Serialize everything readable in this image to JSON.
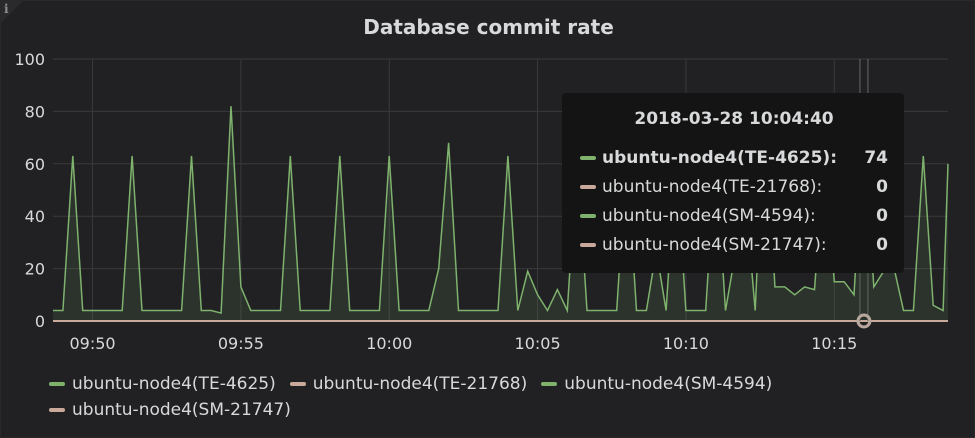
{
  "panel": {
    "title": "Database commit rate",
    "info_icon": "i"
  },
  "chart_data": {
    "type": "line",
    "title": "Database commit rate",
    "ylim": [
      0,
      100
    ],
    "yticks": [
      0,
      20,
      40,
      60,
      80,
      100
    ],
    "xlim": [
      "09:48:40",
      "10:18:50"
    ],
    "xticks": [
      "09:50",
      "09:55",
      "10:00",
      "10:05",
      "10:10",
      "10:15"
    ],
    "grid": true,
    "legend_position": "bottom",
    "series": [
      {
        "name": "ubuntu-node4(TE-4625)",
        "color": "#7eb26d",
        "points": [
          [
            "09:48:40",
            4
          ],
          [
            "09:49:00",
            4
          ],
          [
            "09:49:20",
            63
          ],
          [
            "09:49:40",
            4
          ],
          [
            "09:50:00",
            4
          ],
          [
            "09:50:20",
            4
          ],
          [
            "09:50:40",
            4
          ],
          [
            "09:51:00",
            4
          ],
          [
            "09:51:20",
            63
          ],
          [
            "09:51:40",
            4
          ],
          [
            "09:52:00",
            4
          ],
          [
            "09:52:20",
            4
          ],
          [
            "09:52:40",
            4
          ],
          [
            "09:53:00",
            4
          ],
          [
            "09:53:20",
            63
          ],
          [
            "09:53:40",
            4
          ],
          [
            "09:54:00",
            4
          ],
          [
            "09:54:20",
            3
          ],
          [
            "09:54:40",
            82
          ],
          [
            "09:55:00",
            13
          ],
          [
            "09:55:20",
            4
          ],
          [
            "09:55:40",
            4
          ],
          [
            "09:56:00",
            4
          ],
          [
            "09:56:20",
            4
          ],
          [
            "09:56:40",
            63
          ],
          [
            "09:57:00",
            4
          ],
          [
            "09:57:20",
            4
          ],
          [
            "09:57:40",
            4
          ],
          [
            "09:58:00",
            4
          ],
          [
            "09:58:20",
            63
          ],
          [
            "09:58:40",
            4
          ],
          [
            "09:59:00",
            4
          ],
          [
            "09:59:20",
            4
          ],
          [
            "09:59:40",
            4
          ],
          [
            "10:00:00",
            63
          ],
          [
            "10:00:20",
            4
          ],
          [
            "10:00:40",
            4
          ],
          [
            "10:01:00",
            4
          ],
          [
            "10:01:20",
            4
          ],
          [
            "10:01:40",
            20
          ],
          [
            "10:02:00",
            68
          ],
          [
            "10:02:20",
            4
          ],
          [
            "10:02:40",
            4
          ],
          [
            "10:03:00",
            4
          ],
          [
            "10:03:20",
            4
          ],
          [
            "10:03:40",
            4
          ],
          [
            "10:04:00",
            63
          ],
          [
            "10:04:20",
            4
          ],
          [
            "10:04:40",
            19
          ],
          [
            "10:05:00",
            10
          ],
          [
            "10:05:20",
            4
          ],
          [
            "10:05:40",
            12
          ],
          [
            "10:06:00",
            4
          ],
          [
            "10:06:20",
            63
          ],
          [
            "10:06:40",
            4
          ],
          [
            "10:07:00",
            4
          ],
          [
            "10:07:20",
            4
          ],
          [
            "10:07:40",
            4
          ],
          [
            "10:08:00",
            63
          ],
          [
            "10:08:20",
            4
          ],
          [
            "10:08:40",
            4
          ],
          [
            "10:09:00",
            27
          ],
          [
            "10:09:20",
            4
          ],
          [
            "10:09:40",
            63
          ],
          [
            "10:10:00",
            4
          ],
          [
            "10:10:20",
            4
          ],
          [
            "10:10:40",
            4
          ],
          [
            "10:11:00",
            64
          ],
          [
            "10:11:20",
            4
          ],
          [
            "10:11:40",
            26
          ],
          [
            "10:12:00",
            48
          ],
          [
            "10:12:20",
            4
          ],
          [
            "10:12:40",
            87
          ],
          [
            "10:13:00",
            13
          ],
          [
            "10:13:20",
            13
          ],
          [
            "10:13:40",
            10
          ],
          [
            "10:14:00",
            13
          ],
          [
            "10:14:20",
            12
          ],
          [
            "10:14:40",
            63
          ],
          [
            "10:15:00",
            15
          ],
          [
            "10:15:20",
            15
          ],
          [
            "10:15:40",
            10
          ],
          [
            "10:16:00",
            74
          ],
          [
            "10:16:20",
            13
          ],
          [
            "10:16:40",
            19
          ],
          [
            "10:17:00",
            21
          ],
          [
            "10:17:20",
            4
          ],
          [
            "10:17:40",
            4
          ],
          [
            "10:18:00",
            63
          ],
          [
            "10:18:20",
            6
          ],
          [
            "10:18:40",
            4
          ],
          [
            "10:18:50",
            60
          ]
        ]
      },
      {
        "name": "ubuntu-node4(TE-21768)",
        "color": "#c8a99a",
        "points": [
          [
            "09:48:40",
            0
          ],
          [
            "10:18:50",
            0
          ]
        ]
      },
      {
        "name": "ubuntu-node4(SM-4594)",
        "color": "#7eb26d",
        "points": [
          [
            "09:48:40",
            0
          ],
          [
            "10:18:50",
            0
          ]
        ]
      },
      {
        "name": "ubuntu-node4(SM-21747)",
        "color": "#c8a99a",
        "points": [
          [
            "09:48:40",
            0
          ],
          [
            "10:18:50",
            0
          ]
        ]
      }
    ]
  },
  "legend": [
    {
      "label": "ubuntu-node4(TE-4625)",
      "color": "#7eb26d"
    },
    {
      "label": "ubuntu-node4(TE-21768)",
      "color": "#c8a99a"
    },
    {
      "label": "ubuntu-node4(SM-4594)",
      "color": "#7eb26d"
    },
    {
      "label": "ubuntu-node4(SM-21747)",
      "color": "#c8a99a"
    }
  ],
  "tooltip": {
    "time": "2018-03-28 10:04:40",
    "rows": [
      {
        "name": "ubuntu-node4(TE-4625):",
        "value": "74",
        "color": "#7eb26d",
        "highlight": true
      },
      {
        "name": "ubuntu-node4(TE-21768):",
        "value": "0",
        "color": "#c8a99a",
        "highlight": false
      },
      {
        "name": "ubuntu-node4(SM-4594):",
        "value": "0",
        "color": "#7eb26d",
        "highlight": false
      },
      {
        "name": "ubuntu-node4(SM-21747):",
        "value": "0",
        "color": "#c8a99a",
        "highlight": false
      }
    ]
  }
}
